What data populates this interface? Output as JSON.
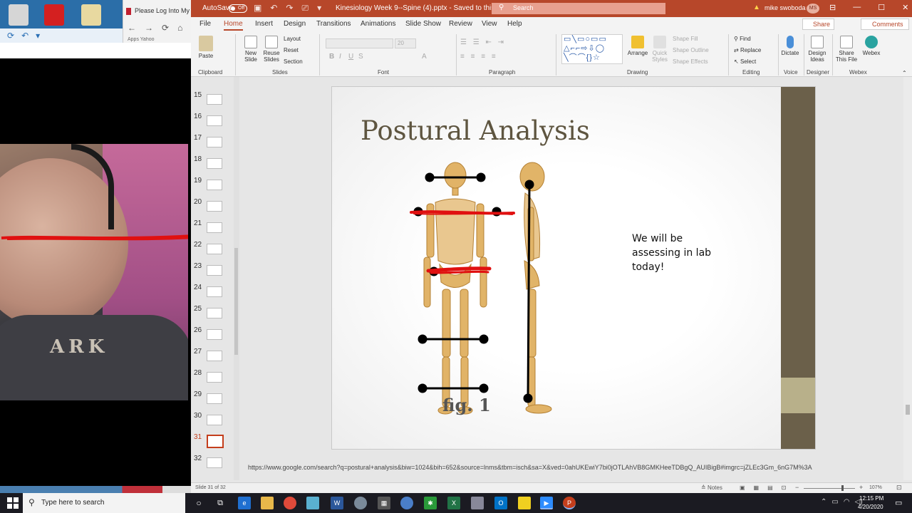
{
  "desktop": {
    "browser_tab_title": "Please Log Into My",
    "nav_glyphs": [
      "←",
      "→",
      "⟳",
      "⌂"
    ],
    "bookmarks": "Apps   Yahoo"
  },
  "webcam": {
    "shirt_text": "ARK"
  },
  "ppt": {
    "autosave_label": "AutoSave",
    "autosave_state": "Off",
    "doc_title": "Kinesiology Week 9--Spine (4).pptx  -  Saved to this PC",
    "search_placeholder": "Search",
    "user_name": "mike swoboda",
    "user_initials": "MS",
    "tabs": [
      "File",
      "Home",
      "Insert",
      "Design",
      "Transitions",
      "Animations",
      "Slide Show",
      "Review",
      "View",
      "Help"
    ],
    "share_label": "Share",
    "comments_label": "Comments",
    "ribbon": {
      "paste": "Paste",
      "clipboard": "Clipboard",
      "new_slide": "New Slide",
      "reuse_slides": "Reuse Slides",
      "layout": "Layout",
      "reset": "Reset",
      "section": "Section",
      "slides": "Slides",
      "font": "Font",
      "font_size": "20",
      "paragraph": "Paragraph",
      "arrange": "Arrange",
      "quick_styles": "Quick Styles",
      "shape_fill": "Shape Fill",
      "shape_outline": "Shape Outline",
      "shape_effects": "Shape Effects",
      "drawing": "Drawing",
      "find": "Find",
      "replace": "Replace",
      "select": "Select",
      "editing": "Editing",
      "dictate": "Dictate",
      "voice": "Voice",
      "design_ideas": "Design Ideas",
      "designer": "Designer",
      "share_this_file": "Share This File",
      "webex": "Webex",
      "webex_group": "Webex"
    },
    "thumbnails": [
      "15",
      "16",
      "17",
      "18",
      "19",
      "20",
      "21",
      "22",
      "23",
      "24",
      "25",
      "26",
      "27",
      "28",
      "29",
      "30",
      "31",
      "32"
    ],
    "selected_slide": "31",
    "slide": {
      "title": "Postural Analysis",
      "body": "We will be assessing in lab today!",
      "figure_label": "fig. 1"
    },
    "notes_link": "https://www.google.com/search?q=postural+analysis&biw=1024&bih=652&source=lnms&tbm=isch&sa=X&ved=0ahUKEwiY7bi0jOTLAhVB8GMKHeeTDBgQ_AUIBigB#imgrc=jZLEc3Gm_6nG7M%3A",
    "status": {
      "slide_count": "Slide 31 of 32",
      "notes": "Notes",
      "zoom": "107%"
    }
  },
  "taskbar": {
    "search_placeholder": "Type here to search",
    "time": "12:15 PM",
    "date": "4/20/2020"
  },
  "colors": {
    "ppt_accent": "#b7472a",
    "slide_title": "#5e5540",
    "slide_bar": "#6b604a",
    "annotation_red": "#e01010"
  }
}
